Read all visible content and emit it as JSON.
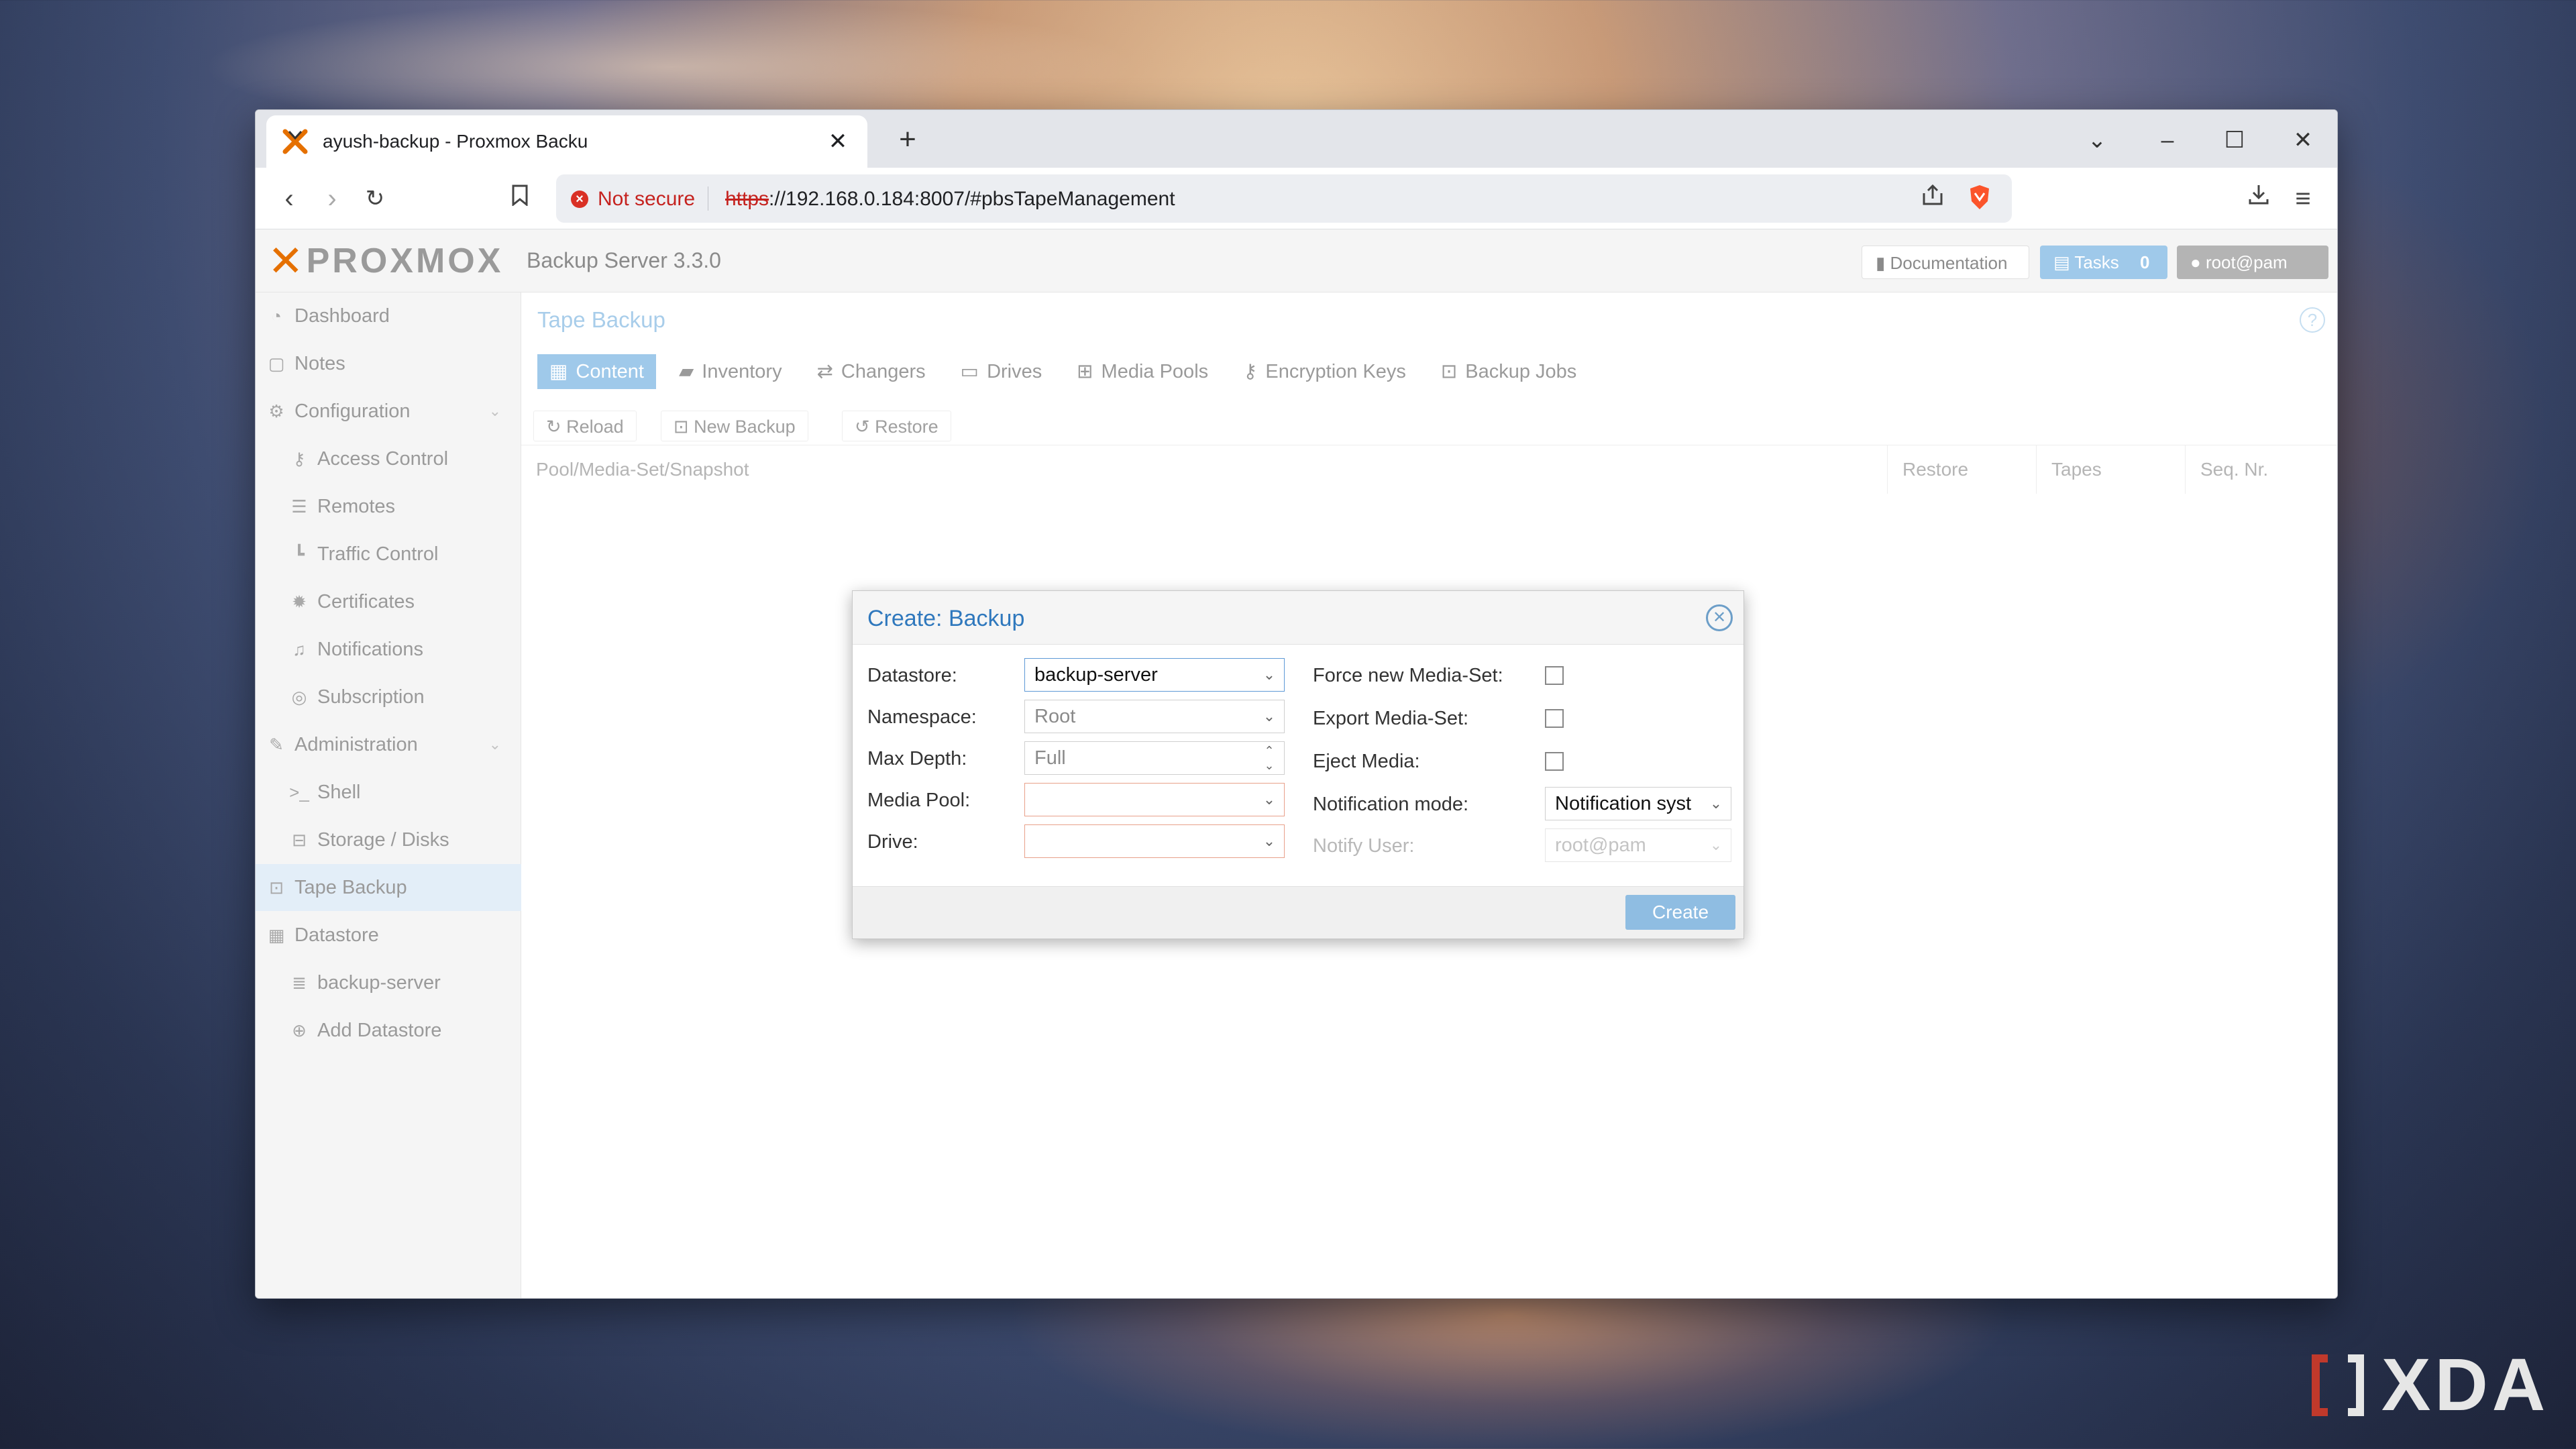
{
  "browser": {
    "tab_title": "ayush-backup - Proxmox Backu",
    "not_secure": "Not secure",
    "url_scheme": "https",
    "url_rest": "://192.168.0.184:8007/#pbsTapeManagement"
  },
  "header": {
    "logo_text": "PROXMOX",
    "product": "Backup Server 3.3.0",
    "documentation": "Documentation",
    "tasks_label": "Tasks",
    "tasks_count": "0",
    "user": "root@pam"
  },
  "sidebar": {
    "items": [
      {
        "label": "Dashboard"
      },
      {
        "label": "Notes"
      },
      {
        "label": "Configuration"
      },
      {
        "label": "Access Control"
      },
      {
        "label": "Remotes"
      },
      {
        "label": "Traffic Control"
      },
      {
        "label": "Certificates"
      },
      {
        "label": "Notifications"
      },
      {
        "label": "Subscription"
      },
      {
        "label": "Administration"
      },
      {
        "label": "Shell"
      },
      {
        "label": "Storage / Disks"
      },
      {
        "label": "Tape Backup"
      },
      {
        "label": "Datastore"
      },
      {
        "label": "backup-server"
      },
      {
        "label": "Add Datastore"
      }
    ]
  },
  "main": {
    "title": "Tape Backup",
    "tabs": [
      "Content",
      "Inventory",
      "Changers",
      "Drives",
      "Media Pools",
      "Encryption Keys",
      "Backup Jobs"
    ],
    "toolbar": {
      "reload": "Reload",
      "new_backup": "New Backup",
      "restore": "Restore"
    },
    "columns": [
      "Pool/Media-Set/Snapshot",
      "Restore",
      "Tapes",
      "Seq. Nr."
    ]
  },
  "dialog": {
    "title": "Create: Backup",
    "labels": {
      "datastore": "Datastore:",
      "namespace": "Namespace:",
      "max_depth": "Max Depth:",
      "media_pool": "Media Pool:",
      "drive": "Drive:",
      "force_new": "Force new Media-Set:",
      "export": "Export Media-Set:",
      "eject": "Eject Media:",
      "notification_mode": "Notification mode:",
      "notify_user": "Notify User:"
    },
    "values": {
      "datastore": "backup-server",
      "namespace": "Root",
      "max_depth": "Full",
      "media_pool": "",
      "drive": "",
      "notification_mode": "Notification syst",
      "notify_user": "root@pam"
    },
    "create": "Create"
  },
  "watermark": "XDA",
  "colors": {
    "accent": "#9fc9ea",
    "proxmox_orange": "#e57000",
    "not_secure_red": "#c5221f"
  }
}
